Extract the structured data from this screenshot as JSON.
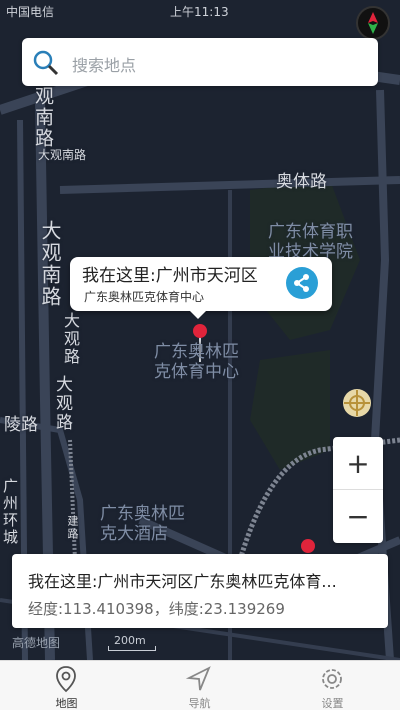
{
  "status_bar": {
    "carrier": "中国电信",
    "time": "上午11:13"
  },
  "search": {
    "placeholder": "搜索地点"
  },
  "map_labels": {
    "guan_road_top": "观南路",
    "dzguan_left": "大观南路",
    "daguan_rd_h": "大观南路",
    "aoti_rd": "奥体路",
    "college": "广东体育职业技术学院",
    "daguan_rd_mid": "大观路",
    "daguan_rd_low": "大观路",
    "sports_center": "广东奥林匹克体育中心",
    "ling_rd": "陵路",
    "hotel": "广东奥林匹克大酒店",
    "huancheng": "广州环城",
    "jian_rd": "建路"
  },
  "popup": {
    "title": "我在这里:广州市天河区",
    "subtitle": "广东奥林匹克体育中心"
  },
  "info_card": {
    "address": "我在这里:广州市天河区广东奥林匹克体育...",
    "coords": "经度:113.410398，纬度:23.139269"
  },
  "zoom": {
    "in_label": "+",
    "out_label": "−"
  },
  "map_footer": {
    "logo": "高德地图",
    "scale": "200m"
  },
  "tabs": [
    {
      "label": "地图",
      "icon": "location-pin-icon",
      "active": true
    },
    {
      "label": "导航",
      "icon": "navigation-arrow-icon",
      "active": false
    },
    {
      "label": "设置",
      "icon": "gear-icon",
      "active": false
    }
  ],
  "colors": {
    "map_bg": "#1c2330",
    "share": "#2a9fd6",
    "pin": "#e0243b"
  }
}
